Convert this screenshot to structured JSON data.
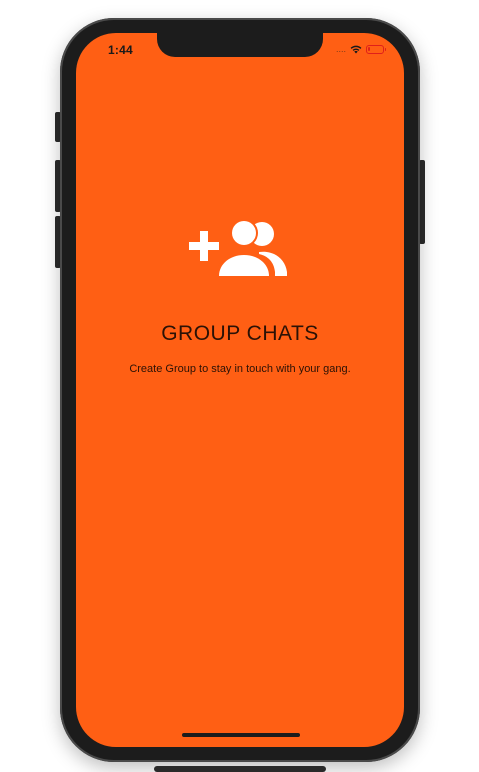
{
  "status_bar": {
    "time": "1:44",
    "signal": "....",
    "battery_level": 0.15
  },
  "screen": {
    "background_color": "#ff5f14",
    "icon": "add-group-icon",
    "title": "GROUP CHATS",
    "subtitle": "Create Group to stay in touch with your gang."
  }
}
